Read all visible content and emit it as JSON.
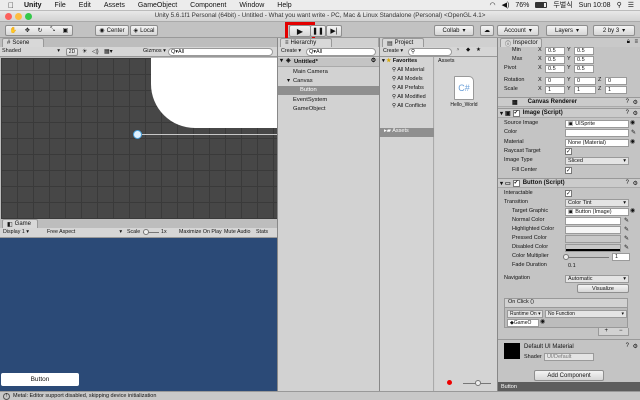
{
  "macbar": {
    "app": "Unity",
    "menus": [
      "File",
      "Edit",
      "Assets",
      "GameObject",
      "Component",
      "Window",
      "Help"
    ],
    "battery": "76%",
    "ime": "두벌식",
    "clock": "Sun 10:08"
  },
  "title": "Unity 5.6.1f1 Personal (64bit) - Untitled - What you want write - PC, Mac & Linux Standalone (Personal) <OpenGL 4.1>",
  "toolbar": {
    "pivot": "Center",
    "space": "Local",
    "collab": "Collab",
    "account": "Account",
    "layers": "Layers",
    "layout": "2 by 3"
  },
  "scene": {
    "tab": "Scene",
    "shading": "Shaded",
    "mode2d": "2D",
    "gizmos": "Gizmos",
    "search": "Q▾All"
  },
  "game": {
    "tab": "Game",
    "display": "Display 1",
    "aspect": "Free Aspect",
    "scale_label": "Scale",
    "scale_value": "1x",
    "maximize": "Maximize On Play",
    "mute": "Mute Audio",
    "stats": "Stats",
    "button_text": "Button"
  },
  "status": "Metal: Editor support disabled, skipping device initialization",
  "hierarchy": {
    "tab": "Hierarchy",
    "create": "Create ▾",
    "search": "Q▾All",
    "scene_name": "Untitled*",
    "items": [
      {
        "label": "Main Camera"
      },
      {
        "label": "Canvas"
      },
      {
        "label": "Button"
      },
      {
        "label": "EventSystem"
      },
      {
        "label": "GameObject"
      }
    ]
  },
  "project": {
    "tab": "Project",
    "create": "Create ▾",
    "favorites_label": "Favorites",
    "favorites": [
      "All Material",
      "All Models",
      "All Prefabs",
      "All Modified",
      "All Conflicte"
    ],
    "assets_root": "Assets",
    "assets_header": "Assets",
    "asset_file": "Hello_World"
  },
  "inspector": {
    "tab": "Inspector",
    "rect": {
      "min_label": "Min",
      "min_x": "0.5",
      "min_y": "0.5",
      "max_label": "Max",
      "max_x": "0.5",
      "max_y": "0.5",
      "pivot_label": "Pivot",
      "pivot_x": "0.5",
      "pivot_y": "0.5",
      "rotation_label": "Rotation",
      "rot_x": "0",
      "rot_y": "0",
      "rot_z": "0",
      "scale_label": "Scale",
      "scale_x": "1",
      "scale_y": "1",
      "scale_z": "1",
      "x": "X",
      "y": "Y",
      "z": "Z"
    },
    "canvas_renderer": "Canvas Renderer",
    "image": {
      "header": "Image (Script)",
      "source_image_label": "Source Image",
      "source_image": "UISprite",
      "color_label": "Color",
      "material_label": "Material",
      "material": "None (Material)",
      "raycast_label": "Raycast Target",
      "image_type_label": "Image Type",
      "image_type": "Sliced",
      "fill_center_label": "Fill Center"
    },
    "button": {
      "header": "Button (Script)",
      "interactable_label": "Interactable",
      "transition_label": "Transition",
      "transition": "Color Tint",
      "target_graphic_label": "Target Graphic",
      "target_graphic": "Button (Image)",
      "normal_label": "Normal Color",
      "highlighted_label": "Highlighted Color",
      "pressed_label": "Pressed Color",
      "disabled_label": "Disabled Color",
      "multiplier_label": "Color Multiplier",
      "multiplier": "1",
      "fade_label": "Fade Duration",
      "fade": "0.1",
      "navigation_label": "Navigation",
      "navigation": "Automatic",
      "visualize": "Visualize",
      "onclick_label": "On Click ()",
      "runtime": "Runtime On ▾",
      "function": "No Function",
      "target_obj": "GameO",
      "plus": "+",
      "minus": "−"
    },
    "material_name": "Default UI Material",
    "shader_label": "Shader",
    "shader": "UI/Default",
    "add_component": "Add Component",
    "footer": "Button"
  }
}
